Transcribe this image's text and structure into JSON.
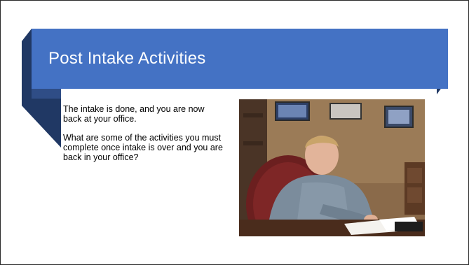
{
  "slide": {
    "title": "Post Intake Activities",
    "paragraphs": [
      "The intake is done, and you are now back at your office.",
      "What are some of the activities you must complete once intake is over and you are back in your office?"
    ],
    "photo": {
      "alt": "",
      "icon": "photo-office-worker"
    }
  },
  "colors": {
    "banner": "#4472c4",
    "banner_shadow": "#203864",
    "banner_fold": "#2f4d86",
    "title_text": "#ffffff",
    "body_text": "#000000"
  }
}
